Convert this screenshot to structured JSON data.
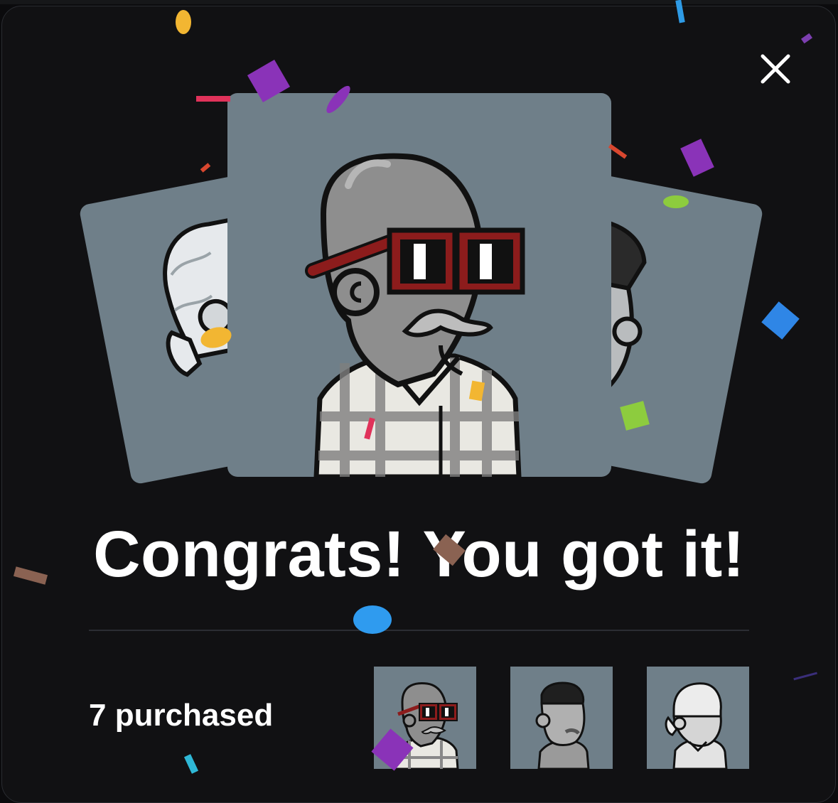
{
  "modal": {
    "close_icon": "close-icon",
    "headline": "Congrats! You got it!",
    "purchased_label": "7 purchased"
  },
  "cards": [
    {
      "position": "left",
      "avatar": "avatar-white-bandana"
    },
    {
      "position": "center",
      "avatar": "avatar-bald-red-glasses-plaid-shirt"
    },
    {
      "position": "right",
      "avatar": "avatar-dark-hair-stubble"
    }
  ],
  "thumbnails": [
    {
      "avatar": "avatar-bald-red-glasses-plaid-shirt"
    },
    {
      "avatar": "avatar-dark-hair-stubble"
    },
    {
      "avatar": "avatar-white-bandana"
    }
  ],
  "colors": {
    "background": "#111113",
    "card": "#6f7f89",
    "glasses": "#8c1c1c",
    "text": "#ffffff"
  }
}
